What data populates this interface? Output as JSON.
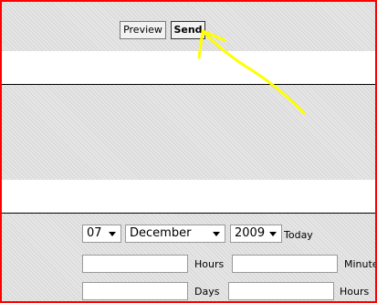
{
  "toolbar": {
    "preview_label": "Preview",
    "send_label": "Send"
  },
  "schedule": {
    "day": "07",
    "month": "December",
    "year": "2009",
    "today_label": "Today",
    "row2": {
      "label1": "Hours",
      "label2": "Minute"
    },
    "row3": {
      "label1": "Days",
      "label2": "Hours"
    }
  },
  "annotation": {
    "arrow_color": "#ffff00"
  },
  "colors": {
    "frame_border": "#ff0000"
  }
}
